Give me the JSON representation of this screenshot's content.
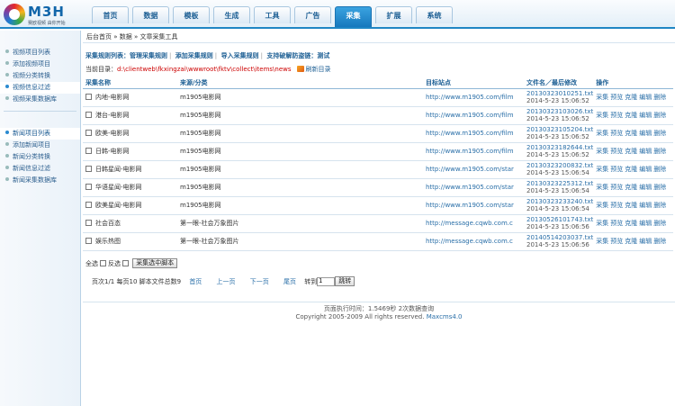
{
  "brand": {
    "name": "M3H",
    "tagline": "赛欧视频 由你开始"
  },
  "nav": [
    "首页",
    "数据",
    "模板",
    "生成",
    "工具",
    "广告",
    "采集",
    "扩展",
    "系统"
  ],
  "nav_active_index": 6,
  "sidebar": {
    "group1": [
      "视频项目列表",
      "添加视频项目",
      "视频分类转换",
      "视频信息过滤",
      "视频采集数据库"
    ],
    "group1_active_index": 3,
    "group2": [
      "新闻项目列表",
      "添加新闻项目",
      "新闻分类转换",
      "新闻信息过滤",
      "新闻采集数据库"
    ],
    "group2_active_index": 0
  },
  "breadcrumb": "后台首页 » 数据 » 文章采集工具",
  "toolbar": {
    "item1": "采集规则列表：管理采集规则",
    "item2": "添加采集规则",
    "item3": "导入采集规则",
    "item4": "支持破解防盗链：测试"
  },
  "current_dir": {
    "label": "当前目录：",
    "path": "d:\\clientweb\\fkxingzai\\wwwroot\\fktv\\collect\\items\\news",
    "refresh": "刷新目录"
  },
  "table": {
    "headers": [
      "采集名称",
      "来源/分类",
      "目标站点",
      "文件名／最后修改",
      "操作"
    ],
    "rows": [
      {
        "name": "内地-电影网",
        "source": "m1905电影网",
        "site": "http://www.m1905.com/film",
        "file": "20130323010251.txt",
        "time": "2014-5-23 15:06:52"
      },
      {
        "name": "港台-电影网",
        "source": "m1905电影网",
        "site": "http://www.m1905.com/film",
        "file": "20130323103026.txt",
        "time": "2014-5-23 15:06:52"
      },
      {
        "name": "欧美-电影网",
        "source": "m1905电影网",
        "site": "http://www.m1905.com/film",
        "file": "20130323105204.txt",
        "time": "2014-5-23 15:06:52"
      },
      {
        "name": "日韩-电影网",
        "source": "m1905电影网",
        "site": "http://www.m1905.com/film",
        "file": "20130323182644.txt",
        "time": "2014-5-23 15:06:52"
      },
      {
        "name": "日韩星闻-电影网",
        "source": "m1905电影网",
        "site": "http://www.m1905.com/star",
        "file": "20130323200832.txt",
        "time": "2014-5-23 15:06:54"
      },
      {
        "name": "华语星闻-电影网",
        "source": "m1905电影网",
        "site": "http://www.m1905.com/star",
        "file": "20130323225312.txt",
        "time": "2014-5-23 15:06:54"
      },
      {
        "name": "欧美星闻-电影网",
        "source": "m1905电影网",
        "site": "http://www.m1905.com/star",
        "file": "20130323233240.txt",
        "time": "2014-5-23 15:06:54"
      },
      {
        "name": "社会百态",
        "source": "第一眼-社会万象图片",
        "site": "http://message.cqwb.com.c",
        "file": "20130526101743.txt",
        "time": "2014-5-23 15:06:56"
      },
      {
        "name": "娱乐热图",
        "source": "第一眼-社会万象图片",
        "site": "http://message.cqwb.com.c",
        "file": "20140514203037.txt",
        "time": "2014-5-23 15:06:56"
      }
    ],
    "ops": [
      "采集",
      "预览",
      "克隆",
      "编辑",
      "删除"
    ]
  },
  "bottom": {
    "select_all": "全选",
    "invert": "反选",
    "collect_btn": "采集选中脚本"
  },
  "pager": {
    "summary": "页次1/1 每页10 脚本文件总数9",
    "first": "首页",
    "prev": "上一页",
    "next": "下一页",
    "last": "尾页",
    "jump_label": "转到",
    "jump_value": "1",
    "jump_btn": "跳转"
  },
  "footer": {
    "line1": "页面执行时间：1.5469秒 2次数据查询",
    "line2_prefix": "Copyright 2005-2009 All rights reserved.",
    "line2_brand": "Maxcms4.0"
  }
}
